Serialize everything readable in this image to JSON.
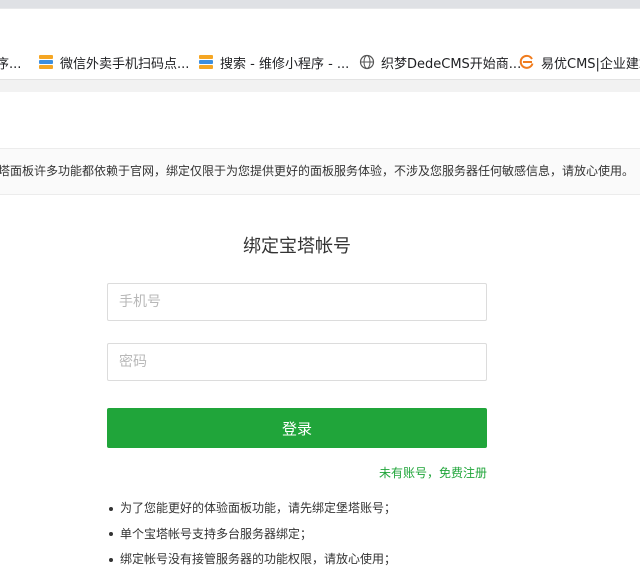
{
  "bookmarks": [
    {
      "label": "序...",
      "icon": "page-icon"
    },
    {
      "label": "微信外卖手机扫码点...",
      "icon": "stack-icon"
    },
    {
      "label": "搜索 - 维修小程序 - ...",
      "icon": "stack-icon"
    },
    {
      "label": "织梦DedeCMS开始商...",
      "icon": "globe-icon"
    },
    {
      "label": "易优CMS|企业建站",
      "icon": "eyou-logo-icon"
    }
  ],
  "notice": {
    "text": "塔面板许多功能都依赖于官网，绑定仅限于为您提供更好的面板服务体验，不涉及您服务器任何敏感信息，请放心使用。"
  },
  "form": {
    "title": "绑定宝塔帐号",
    "phone_placeholder": "手机号",
    "password_placeholder": "密码",
    "login_label": "登录",
    "register_link": "未有账号，免费注册"
  },
  "tips": [
    "为了您能更好的体验面板功能，请先绑定堡塔账号；",
    "单个宝塔帐号支持多台服务器绑定；",
    "绑定帐号没有接管服务器的功能权限，请放心使用；"
  ],
  "colors": {
    "accent": "#20a53a",
    "notice_background": "#fafafa"
  }
}
